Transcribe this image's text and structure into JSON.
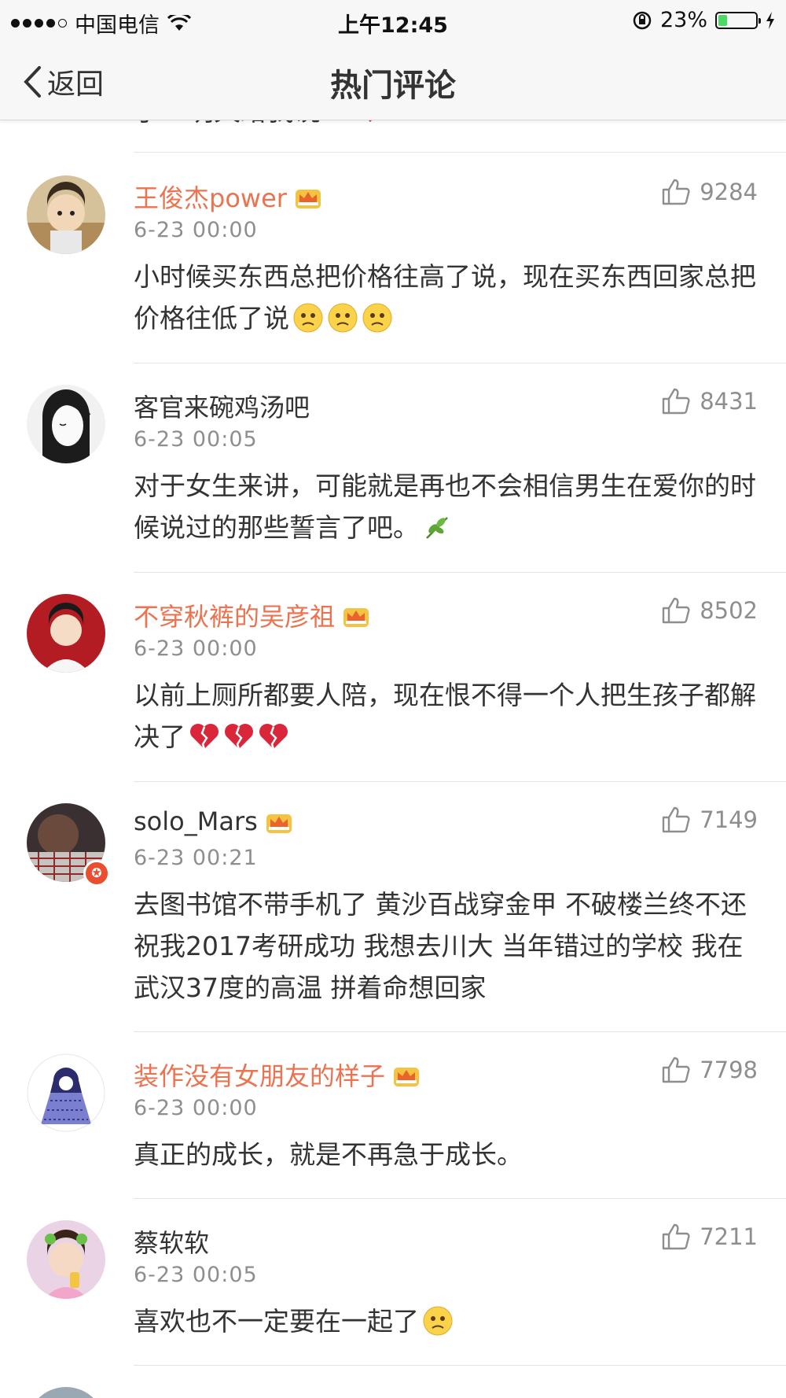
{
  "status_bar": {
    "carrier": "中国电信",
    "time": "上午12:45",
    "battery": "23%",
    "battery_level": 0.23
  },
  "nav": {
    "back_label": "返回",
    "title": "热门评论"
  },
  "partial_comment": "了一明天给我说…",
  "comments": [
    {
      "username": "王俊杰power",
      "vip": true,
      "time": "6-23 00:00",
      "likes": "9284",
      "text": "小时候买东西总把价格往高了说，现在买东西回家总把价格往低了说",
      "emojis": [
        "sad-face-emoji",
        "sad-face-emoji",
        "sad-face-emoji"
      ]
    },
    {
      "username": "客官来碗鸡汤吧",
      "vip": false,
      "time": "6-23 00:05",
      "likes": "8431",
      "text": "对于女生来讲，可能就是再也不会相信男生在爱你的时候说过的那些誓言了吧。",
      "emojis": [
        "leaf-emoji"
      ]
    },
    {
      "username": "不穿秋裤的吴彦祖",
      "vip": true,
      "time": "6-23 00:00",
      "likes": "8502",
      "text": "以前上厕所都要人陪，现在恨不得一个人把生孩子都解决了",
      "emojis": [
        "broken-heart-emoji",
        "broken-heart-emoji",
        "broken-heart-emoji"
      ]
    },
    {
      "username": "solo_Mars",
      "vip": false,
      "time": "6-23 00:21",
      "likes": "7149",
      "text": "去图书馆不带手机了 黄沙百战穿金甲 不破楼兰终不还 祝我2017考研成功 我想去川大 当年错过的学校 我在武汉37度的高温 拼着命想回家",
      "emojis": []
    },
    {
      "username": "装作没有女朋友的样子",
      "vip": true,
      "time": "6-23 00:00",
      "likes": "7798",
      "text": "真正的成长，就是不再急于成长。",
      "emojis": []
    },
    {
      "username": "蔡软软",
      "vip": false,
      "time": "6-23 00:05",
      "likes": "7211",
      "text": "喜欢也不一定要在一起了",
      "emojis": [
        "sad-face-emoji"
      ]
    }
  ],
  "colors": {
    "vip_name": "#eb7350",
    "meta_gray": "#8e8e8e",
    "text": "#333333"
  }
}
